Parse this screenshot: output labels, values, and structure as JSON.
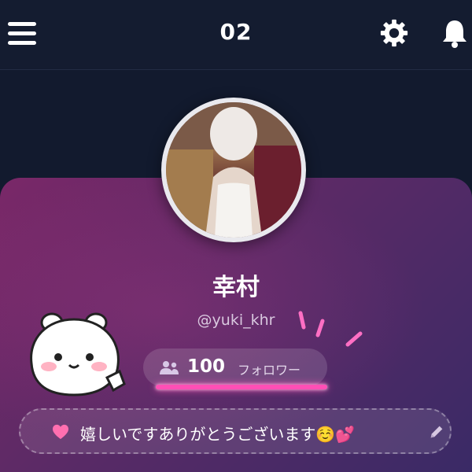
{
  "header": {
    "title": "02",
    "menu_icon": "hamburger-menu-icon",
    "settings_icon": "gear-icon",
    "notifications_icon": "bell-icon"
  },
  "profile": {
    "name": "幸村",
    "handle": "@yuki_khr",
    "followers": {
      "count": "100",
      "label": "フォロワー",
      "icon": "people-icon"
    },
    "status": {
      "text": "嬉しいですありがとうございます☺️💕",
      "icon": "heart-icon",
      "edit_icon": "pencil-icon"
    }
  },
  "colors": {
    "background": "#121a2e",
    "card_gradient_start": "#7a2868",
    "card_gradient_end": "#3a2a66",
    "accent_glow": "#ff4fb5",
    "heart": "#ff6fb0"
  }
}
